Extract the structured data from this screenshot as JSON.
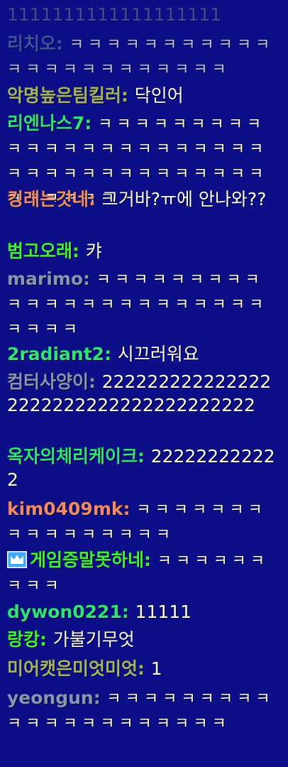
{
  "colors": {
    "background": "#0d0f88",
    "message_text": "#ffffff",
    "nick_gray": "#8a93b8",
    "nick_olive": "#a5b36a",
    "nick_green": "#34e07a",
    "nick_salmon": "#f08a6a",
    "nick_lime": "#41f03a",
    "crown": "#3fa9ff"
  },
  "messages": [
    {
      "nick": "",
      "text": "1111111111111111111"
    },
    {
      "nick": "리치오",
      "text": "ㅋㅋㅋㅋㅋㅋㅋㅋㅋㅋㅋㅋㅋㅋㅋㅋㅋㅋㅋㅋㅋㅋㅋ"
    },
    {
      "nick": "악명높은팀킬러",
      "text": "닥인어"
    },
    {
      "nick": "리엔나스7",
      "text": "ㅋㅋㅋㅋㅋㅋㅋㅋㅋㅋㅋㅋㅋㅋㅋㅋㅋㅋㅋㅋㅋㅋㅋㅋㅋㅋㅋㅋㅋㅋㅋㅋㅋㅋㅋㅋㅋㅋㅋㅋㅋㅋㅋ"
    },
    {
      "nick": "킹래는갓네",
      "text": "그거바?ㅠ에 안나와??"
    },
    {
      "nick": "범고오래",
      "text": "캬"
    },
    {
      "nick": "marimo",
      "text": "ㅋㅋㅋㅋㅋㅋㅋㅋㅋㅋㅋㅋㅋㅋㅋㅋㅋㅋㅋㅋㅋㅋㅋㅋㅋㅋㅋ"
    },
    {
      "nick": "2radiant2",
      "text": "시끄러워요"
    },
    {
      "nick": "컴터사양이",
      "text": "2222222222222222222222222222222222222"
    },
    {
      "nick": "옥자의체리케이크",
      "text": "222222222222"
    },
    {
      "nick": "kim0409mk",
      "text": "ㅋㅋㅋㅋㅋㅋㅋㅋㅋㅋㅋㅋㅋㅋㅋㅋ"
    },
    {
      "nick": "게임증말못하네",
      "text": "ㅋㅋㅋㅋㅋㅋㅋㅋㅋ",
      "badge": "crown-icon"
    },
    {
      "nick": "dywon0221",
      "text": "11111"
    },
    {
      "nick": "랑캉",
      "text": "가불기무엇"
    },
    {
      "nick": "미어캣은미엇미엇",
      "text": "1"
    },
    {
      "nick": "yeongun",
      "text": "ㅋㅋㅋㅋㅋㅋㅋㅋㅋㅋㅋㅋㅋㅋㅋㅋㅋㅋㅋㅋㅋ"
    }
  ]
}
